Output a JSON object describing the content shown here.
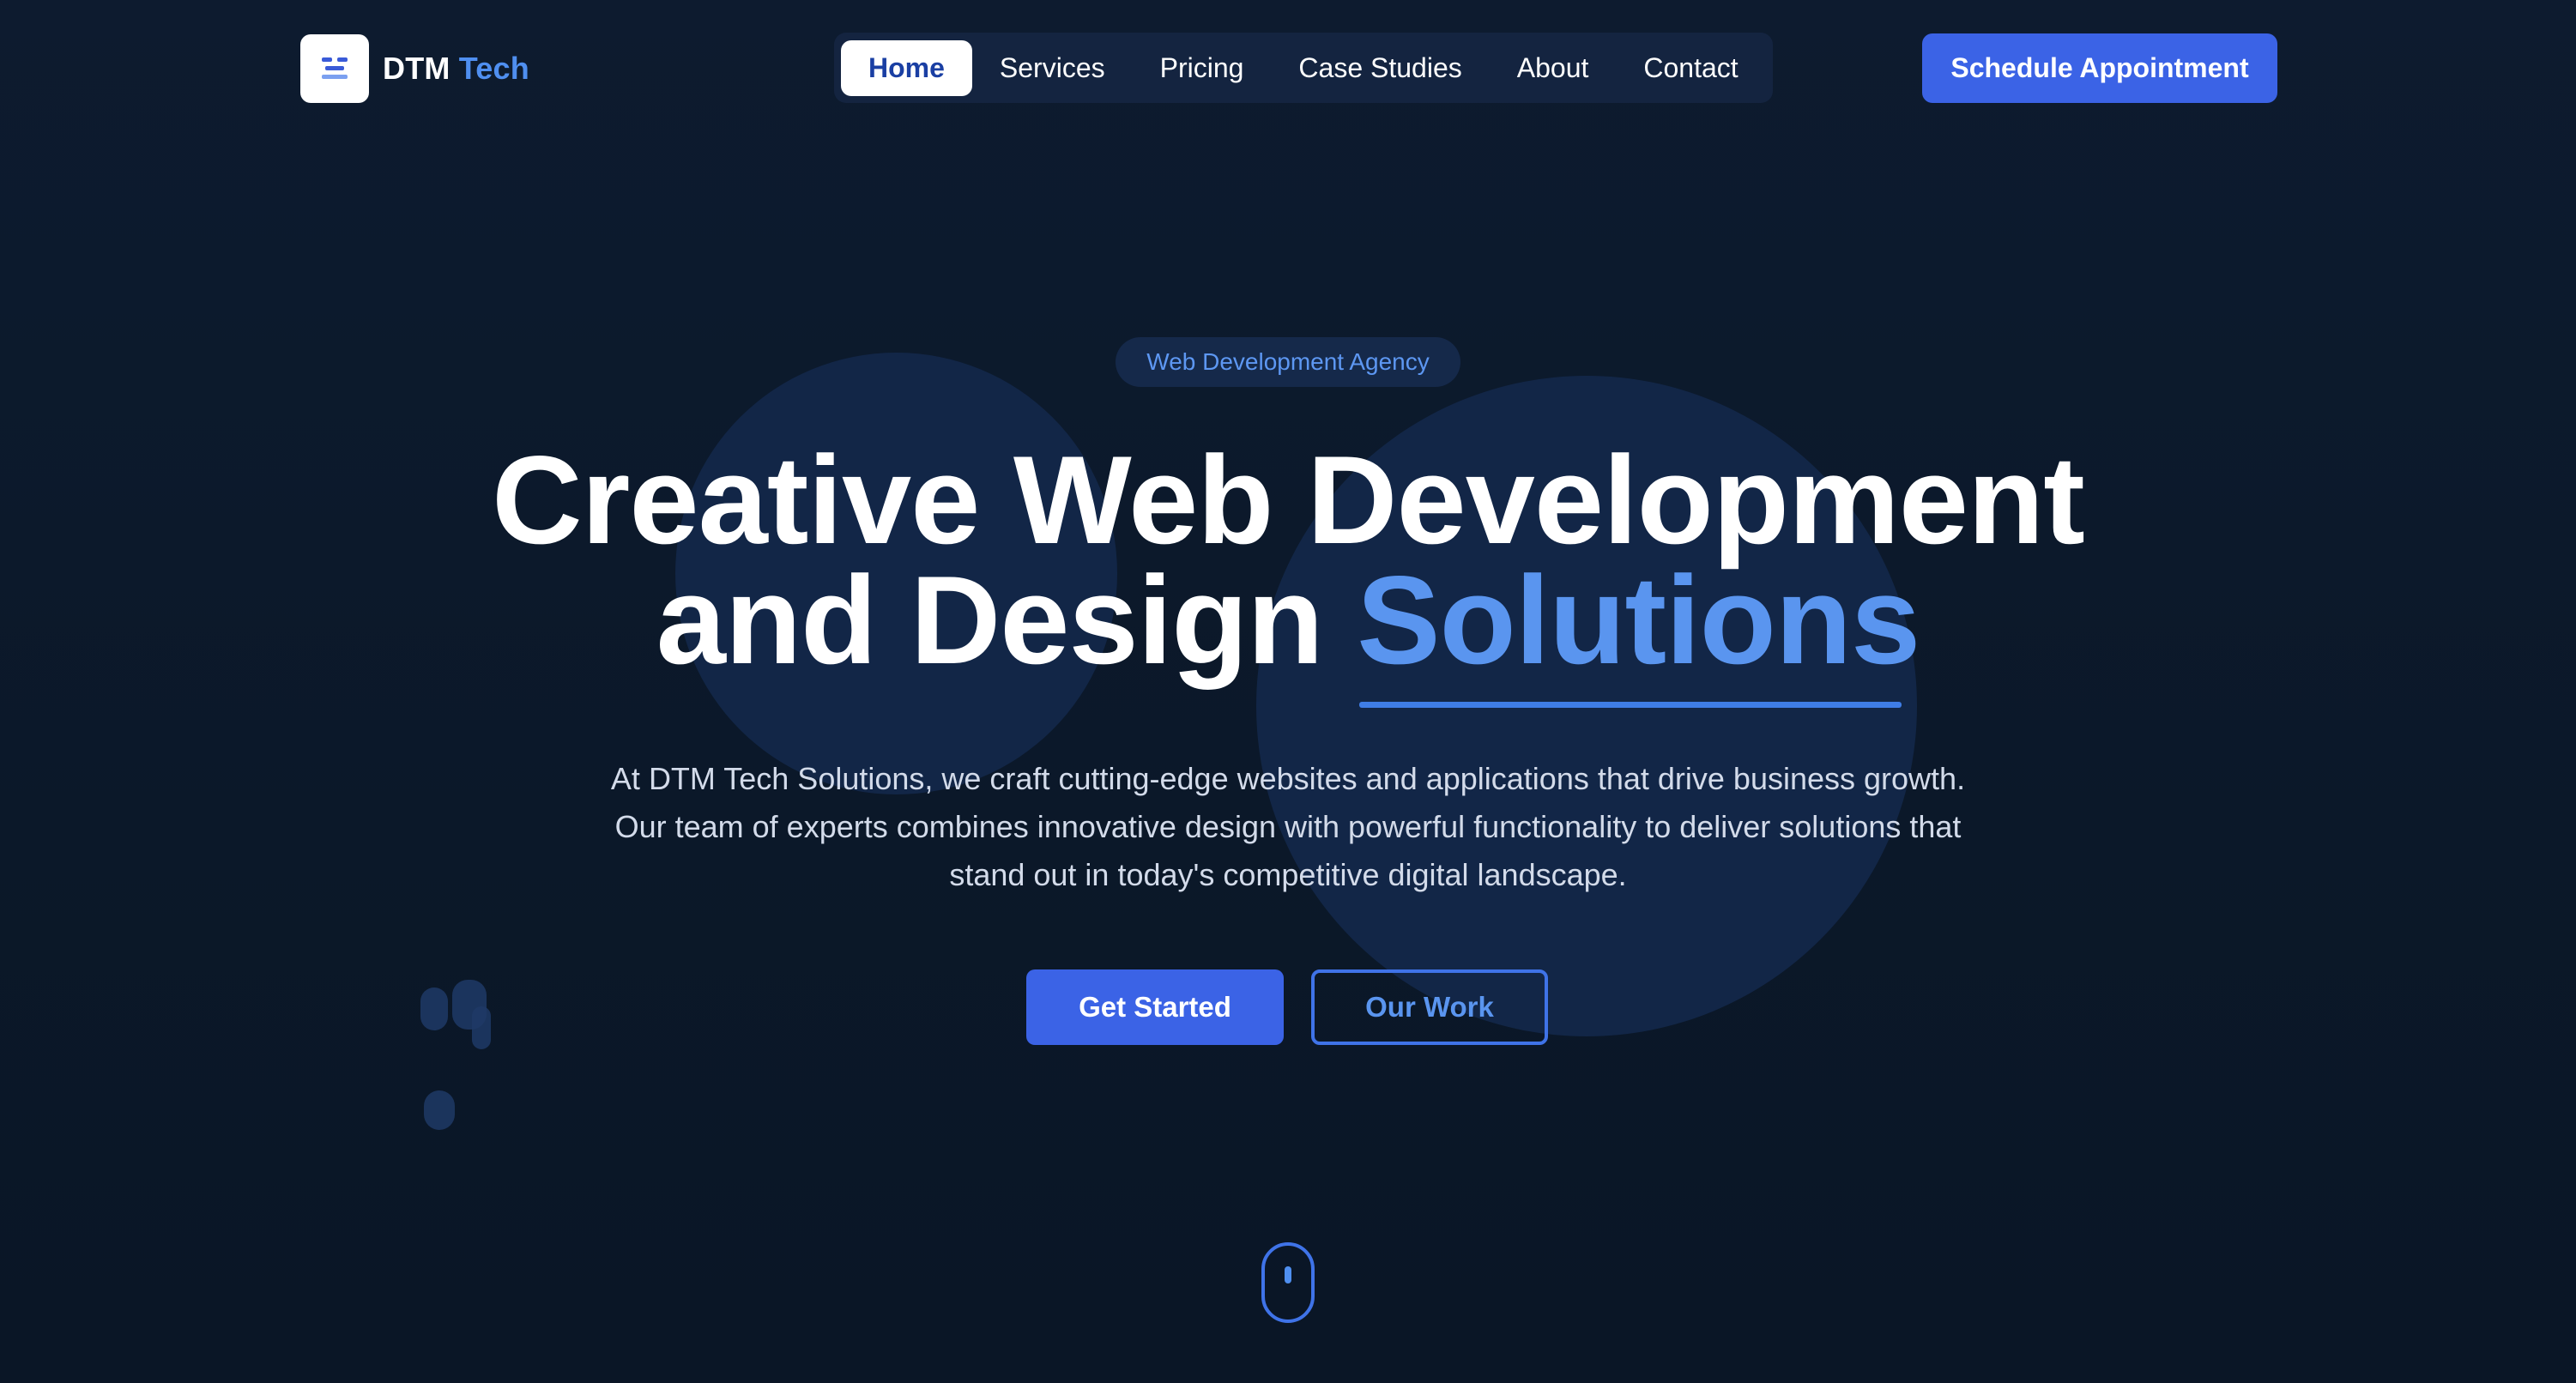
{
  "brand": {
    "name_main": "DTM",
    "name_accent": "Tech"
  },
  "nav": {
    "items": [
      {
        "label": "Home",
        "active": true
      },
      {
        "label": "Services",
        "active": false
      },
      {
        "label": "Pricing",
        "active": false
      },
      {
        "label": "Case Studies",
        "active": false
      },
      {
        "label": "About",
        "active": false
      },
      {
        "label": "Contact",
        "active": false
      }
    ],
    "cta_label": "Schedule Appointment"
  },
  "hero": {
    "badge": "Web Development Agency",
    "headline_line1": "Creative Web Development",
    "headline_line2_prefix": "and Design ",
    "headline_line2_accent": "Solutions",
    "description": "At DTM Tech Solutions, we craft cutting-edge websites and applications that drive business growth. Our team of experts combines innovative design with powerful functionality to deliver solutions that stand out in today's competitive digital landscape.",
    "primary_button": "Get Started",
    "secondary_button": "Our Work"
  },
  "icons": {
    "logo": "dtm-logo-icon",
    "scroll": "scroll-mouse-icon"
  },
  "colors": {
    "background": "#0c1a2e",
    "accent": "#3b63e6",
    "accent_text": "#5a95ef",
    "nav_bg": "#142440"
  }
}
